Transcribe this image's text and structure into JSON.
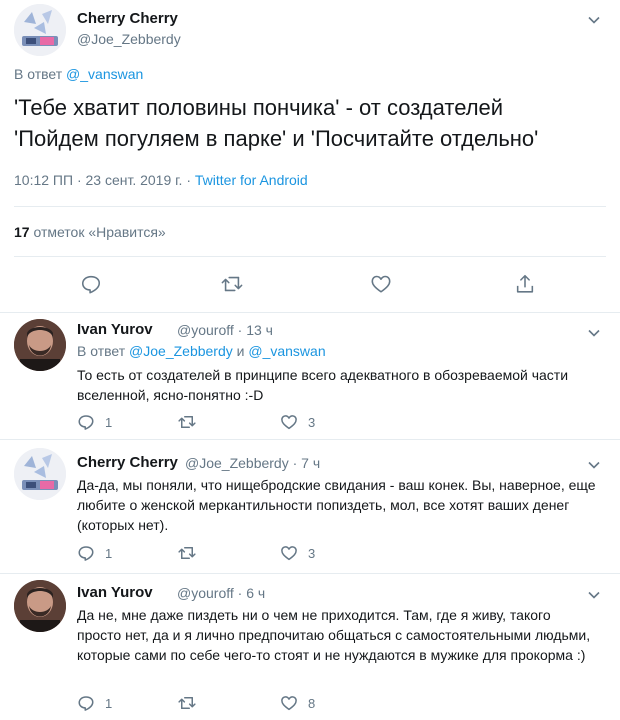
{
  "main": {
    "name": "Cherry Cherry",
    "handle": "@Joe_Zebberdy",
    "reply_prefix": "В ответ",
    "reply_to": "@_vanswan",
    "text_line1": "'Тебе хватит половины пончика' - от создателей",
    "text_line2": "'Пойдем погуляем в парке' и 'Посчитайте отдельно'",
    "time_date": "10:12 ПП · 23 сент. 2019 г. · ",
    "source": "Twitter for Android",
    "likes_count": "17",
    "likes_label": " отметок «Нравится»"
  },
  "replies": [
    {
      "name": "Ivan Yurov",
      "handle_time": "@youroff · 13 ч",
      "reply_prefix": "В ответ",
      "reply_to_1": "@Joe_Zebberdy",
      "reply_and": "и",
      "reply_to_2": "@_vanswan",
      "text": "То есть от создателей в принципе всего адекватного в обозреваемой части вселенной, ясно-понятно :-D",
      "reply_count": "1",
      "like_count": "3"
    },
    {
      "name": "Cherry Cherry",
      "handle_time": "@Joe_Zebberdy · 7 ч",
      "text": "Да-да, мы поняли, что нищебродские свидания - ваш конек. Вы, наверное, еще любите о женской меркантильности попиздеть, мол, все хотят ваших денег (которых нет).",
      "reply_count": "1",
      "like_count": "3"
    },
    {
      "name": "Ivan Yurov",
      "handle_time": "@youroff · 6 ч",
      "text": "Да не, мне даже пиздеть ни о чем не приходится. Там, где я живу, такого просто нет, да и я лично предпочитаю общаться с самостоятельными людьми, которые сами по себе чего-то стоят и не нуждаются в мужике для прокорма :)",
      "reply_count": "1",
      "like_count": "8"
    }
  ],
  "colors": {
    "link": "#1b95e0",
    "secondary_text": "#657786",
    "primary_text": "#14171a",
    "divider": "#e6ecf0"
  },
  "icons": [
    "chevron-down-icon",
    "reply-icon",
    "retweet-icon",
    "like-icon",
    "share-icon"
  ]
}
